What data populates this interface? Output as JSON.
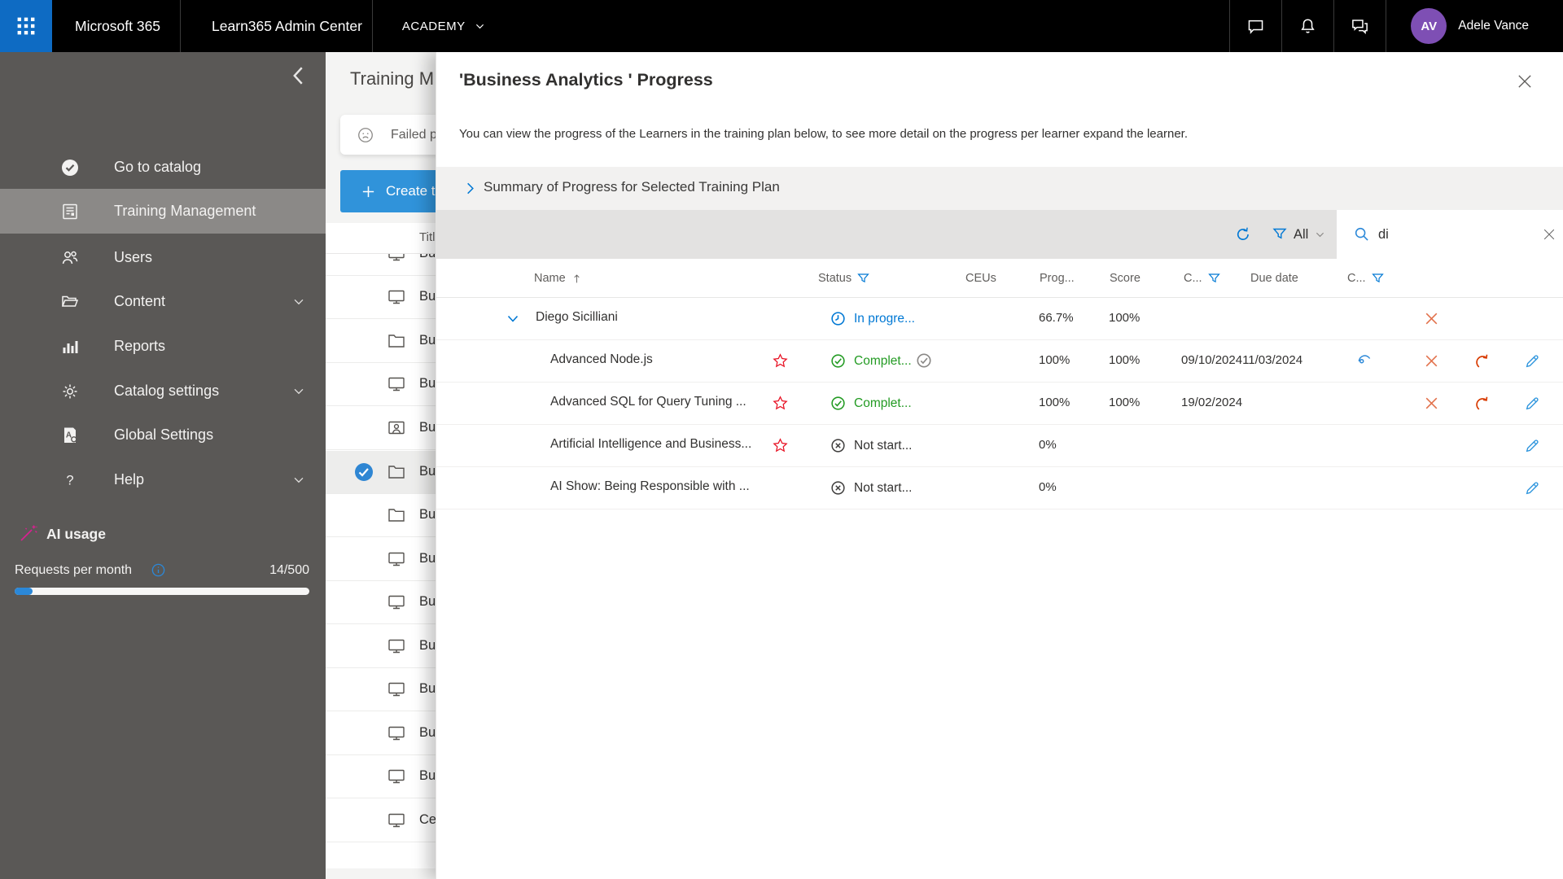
{
  "colors": {
    "topbar_black": "#000000",
    "waffle_blue": "#0e6bc3",
    "accent_blue": "#0078d4",
    "create_button_blue": "#3093da",
    "completed_green": "#239b23",
    "in_progress_blue": "#0078d4",
    "not_started_gray": "#3d3c3b",
    "delete_orange": "#e2714b",
    "redo_orange": "#d83b01",
    "star_red": "#e81123",
    "edit_blue": "#2e95dd",
    "avatar_purple": "#7e4fb4",
    "ai_wand_pink": "#d6218f",
    "sidebar_gray": "#5a5856",
    "sidebar_selected_gray": "#8b8987"
  },
  "top_bar": {
    "brand": "Microsoft 365",
    "app_title": "Learn365 Admin Center",
    "tenant": "ACADEMY",
    "user_initials": "AV",
    "user_name": "Adele Vance"
  },
  "sidebar": {
    "items": [
      {
        "label": "Go to catalog",
        "icon": "go-to-catalog",
        "selected": false,
        "expandable": false
      },
      {
        "label": "Training Management",
        "icon": "training-management",
        "selected": true,
        "expandable": false
      },
      {
        "label": "Users",
        "icon": "users",
        "selected": false,
        "expandable": false
      },
      {
        "label": "Content",
        "icon": "content-folder",
        "selected": false,
        "expandable": true
      },
      {
        "label": "Reports",
        "icon": "reports",
        "selected": false,
        "expandable": false
      },
      {
        "label": "Catalog settings",
        "icon": "catalog-settings",
        "selected": false,
        "expandable": true
      },
      {
        "label": "Global Settings",
        "icon": "global-settings",
        "selected": false,
        "expandable": false
      },
      {
        "label": "Help",
        "icon": "help",
        "selected": false,
        "expandable": true
      }
    ],
    "ai_usage_label": "AI usage",
    "requests_label": "Requests per month",
    "requests_value": "14/500",
    "requests_progress": {
      "current": 14,
      "max": 500
    }
  },
  "training_list": {
    "title": "Training M",
    "alert_text": "Failed pro",
    "create_button": "Create tra",
    "column_header": "Titl",
    "rows": [
      {
        "icon": "monitor",
        "label": "Bu",
        "selected": false
      },
      {
        "icon": "monitor",
        "label": "Bu",
        "selected": false
      },
      {
        "icon": "folder",
        "label": "Bu",
        "selected": false
      },
      {
        "icon": "monitor",
        "label": "Bu",
        "selected": false
      },
      {
        "icon": "person-frame",
        "label": "Bu",
        "selected": false
      },
      {
        "icon": "folder",
        "label": "Bu",
        "selected": true
      },
      {
        "icon": "folder",
        "label": "Bu",
        "selected": false
      },
      {
        "icon": "monitor",
        "label": "Bu",
        "selected": false
      },
      {
        "icon": "monitor",
        "label": "Bu",
        "selected": false
      },
      {
        "icon": "monitor",
        "label": "Bu",
        "selected": false
      },
      {
        "icon": "monitor",
        "label": "Bu",
        "selected": false
      },
      {
        "icon": "monitor",
        "label": "Bu",
        "selected": false
      },
      {
        "icon": "monitor",
        "label": "Bu",
        "selected": false
      },
      {
        "icon": "monitor",
        "label": "Ce",
        "selected": false
      }
    ]
  },
  "progress_panel": {
    "title": "'Business Analytics ' Progress",
    "description": "You can view the progress of the Learners in the training plan below, to see more detail on the progress per learner expand the learner.",
    "summary_label": "Summary of Progress for Selected Training Plan",
    "toolbar": {
      "filter_value": "All",
      "search_value": "di"
    },
    "table": {
      "columns": {
        "name": "Name",
        "status": "Status",
        "ceus": "CEUs",
        "progress": "Prog...",
        "score": "Score",
        "completion": "C...",
        "due_date": "Due date",
        "certificate": "C..."
      },
      "rows": [
        {
          "kind": "learner",
          "name": "Diego Sicilliani",
          "starred": false,
          "status": "In progre...",
          "status_kind": "in-progress",
          "status_extra_check": false,
          "progress": "66.7%",
          "score": "100%",
          "dates": "",
          "actions": [
            "delete"
          ],
          "expanded": true
        },
        {
          "kind": "course",
          "name": "Advanced Node.js",
          "starred": true,
          "status": "Complet...",
          "status_kind": "completed",
          "status_extra_check": true,
          "progress": "100%",
          "score": "100%",
          "dates": "09/10/202411/03/2024",
          "actions": [
            "view",
            "delete",
            "redo",
            "edit"
          ]
        },
        {
          "kind": "course",
          "name": "Advanced SQL for Query Tuning ...",
          "starred": true,
          "status": "Complet...",
          "status_kind": "completed",
          "status_extra_check": false,
          "progress": "100%",
          "score": "100%",
          "dates": "19/02/2024",
          "actions": [
            "delete",
            "redo",
            "edit"
          ]
        },
        {
          "kind": "course",
          "name": "Artificial Intelligence and Business...",
          "starred": true,
          "status": "Not start...",
          "status_kind": "not-started",
          "status_extra_check": false,
          "progress": "0%",
          "score": "",
          "dates": "",
          "actions": [
            "edit"
          ]
        },
        {
          "kind": "course",
          "name": "AI Show: Being Responsible with ...",
          "starred": false,
          "status": "Not start...",
          "status_kind": "not-started",
          "status_extra_check": false,
          "progress": "0%",
          "score": "",
          "dates": "",
          "actions": [
            "edit"
          ]
        }
      ]
    }
  }
}
